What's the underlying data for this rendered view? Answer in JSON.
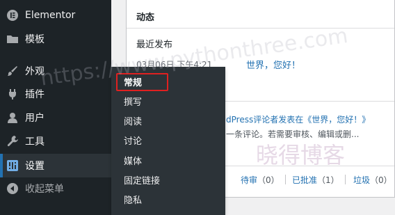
{
  "sidebar": {
    "items": [
      {
        "label": "Elementor",
        "icon": "elementor-icon"
      },
      {
        "label": "模板",
        "icon": "folder-icon"
      },
      {
        "label": "外观",
        "icon": "paintbrush-icon"
      },
      {
        "label": "插件",
        "icon": "plugin-icon"
      },
      {
        "label": "用户",
        "icon": "user-icon"
      },
      {
        "label": "工具",
        "icon": "wrench-icon"
      },
      {
        "label": "设置",
        "icon": "settings-icon"
      },
      {
        "label": "收起菜单",
        "icon": "collapse-icon"
      }
    ]
  },
  "submenu": {
    "items": [
      "常规",
      "撰写",
      "阅读",
      "讨论",
      "媒体",
      "固定链接",
      "隐私"
    ]
  },
  "widget": {
    "title": "动态",
    "recent_label": "最近发布",
    "post_date": "03月06日 下午4:21",
    "post_title": "世界，您好！",
    "comment_author": "dPress评论者发表在",
    "comment_post": "《世界，您好！》",
    "comment_excerpt": "一条评论。若需要审核、编辑或删...",
    "stats": {
      "pending_label": "待审",
      "pending_count": "（0）",
      "approved_label": "已批准",
      "approved_count": "（1）",
      "spam_label": "垃圾",
      "spam_count": "（0）"
    }
  },
  "watermark": {
    "url": "https://www.pythonthree.com",
    "site": "晓得博客"
  },
  "colors": {
    "sidebar_bg": "#1d2327",
    "submenu_bg": "#2c3338",
    "accent": "#2271b1",
    "highlight": "#e02020"
  }
}
